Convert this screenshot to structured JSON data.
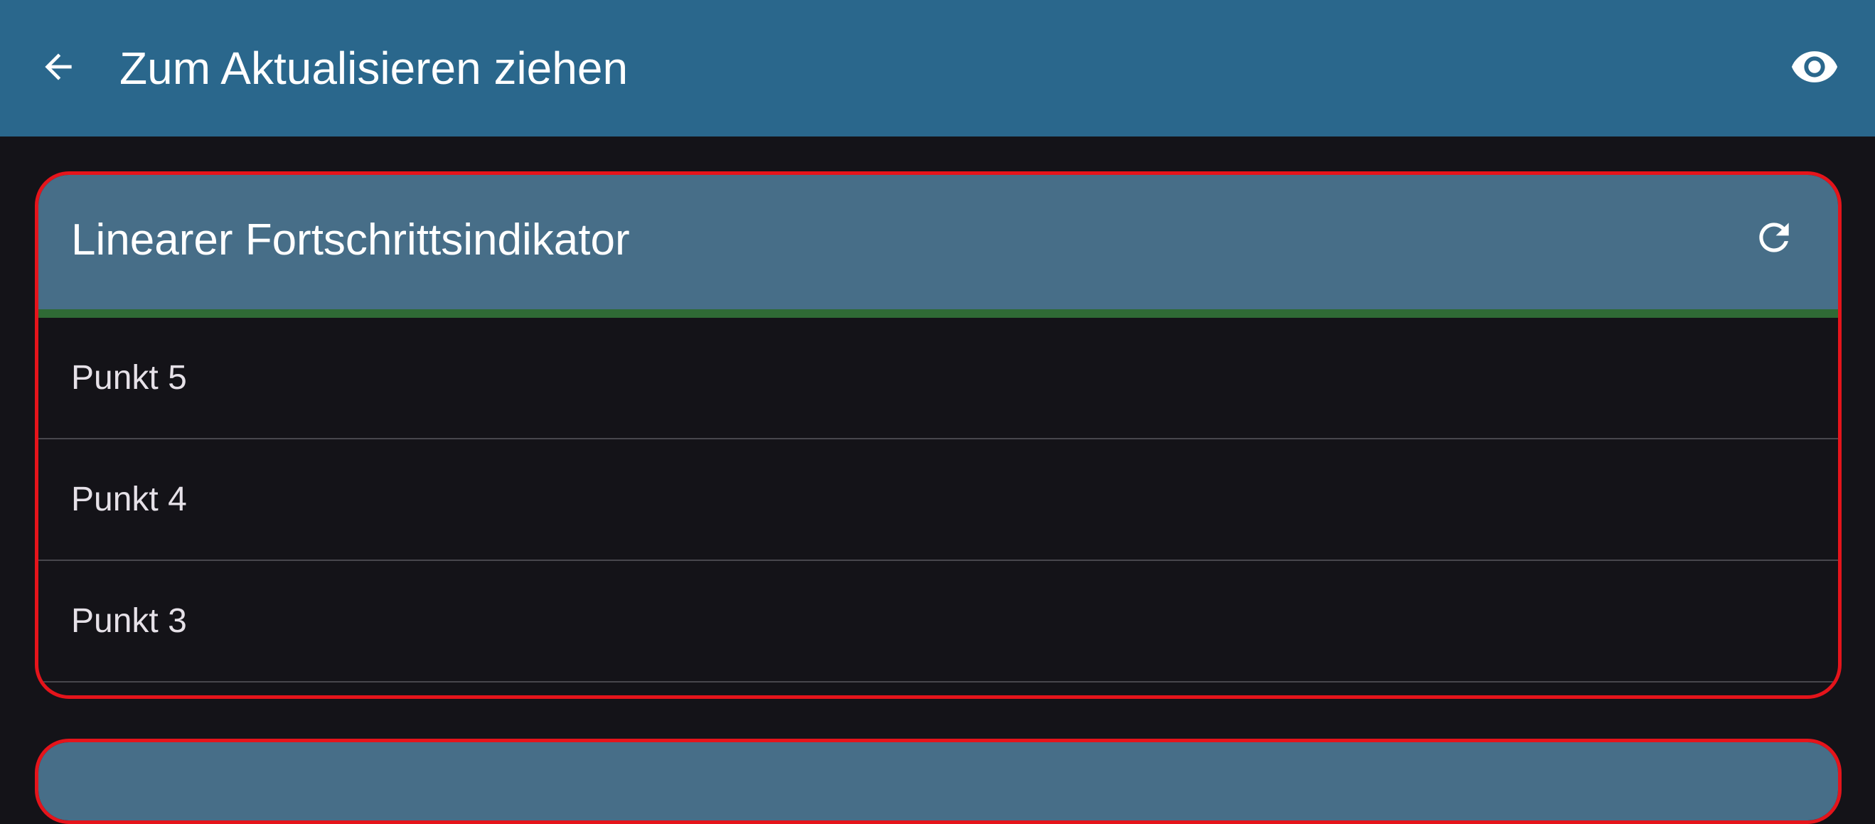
{
  "app_bar": {
    "title": "Zum Aktualisieren ziehen",
    "back_icon": "arrow-back-icon",
    "visibility_icon": "eye-icon",
    "background": "#2a678c"
  },
  "card": {
    "title": "Linearer Fortschrittsindikator",
    "refresh_icon": "refresh-icon",
    "header_background": "#476e88",
    "border_color": "#e5141b",
    "progress": {
      "value": 1.0,
      "color": "#2f6a35"
    },
    "items": [
      {
        "label": "Punkt 5"
      },
      {
        "label": "Punkt 4"
      },
      {
        "label": "Punkt 3"
      }
    ]
  }
}
